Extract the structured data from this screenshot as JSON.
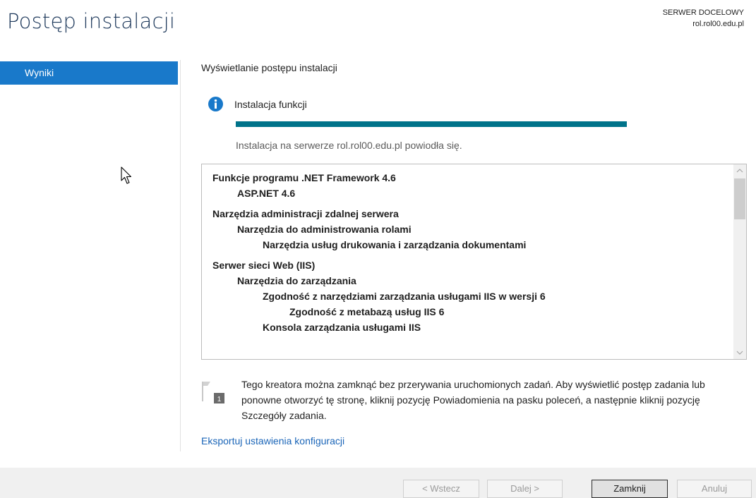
{
  "header": {
    "title": "Postęp instalacji",
    "server_label": "SERWER DOCELOWY",
    "server_name": "rol.rol00.edu.pl"
  },
  "sidebar": {
    "items": [
      {
        "label": "Wyniki",
        "selected": true
      }
    ]
  },
  "main": {
    "section_label": "Wyświetlanie postępu instalacji",
    "info_title": "Instalacja funkcji",
    "progress_percent": 100,
    "status_text": "Instalacja na serwerze rol.rol00.edu.pl powiodła się.",
    "results": [
      {
        "text": "Funkcje programu .NET Framework 4.6",
        "level": 0
      },
      {
        "text": "ASP.NET 4.6",
        "level": 1
      },
      {
        "text": "Narzędzia administracji zdalnej serwera",
        "level": 0
      },
      {
        "text": "Narzędzia do administrowania rolami",
        "level": 1
      },
      {
        "text": "Narzędzia usług drukowania i zarządzania dokumentami",
        "level": 2
      },
      {
        "text": "Serwer sieci Web (IIS)",
        "level": 0
      },
      {
        "text": "Narzędzia do zarządzania",
        "level": 1
      },
      {
        "text": "Zgodność z narzędziami zarządzania usługami IIS w wersji 6",
        "level": 2
      },
      {
        "text": "Zgodność z metabazą usług IIS 6",
        "level": 3
      },
      {
        "text": "Konsola zarządzania usługami IIS",
        "level": 2
      }
    ],
    "note_text": "Tego kreatora można zamknąć bez przerywania uruchomionych zadań. Aby wyświetlić postęp zadania lub ponowne otworzyć tę stronę, kliknij pozycję Powiadomienia na pasku poleceń, a następnie kliknij pozycję Szczegóły zadania.",
    "note_badge": "1",
    "export_link": "Eksportuj ustawienia konfiguracji"
  },
  "footer": {
    "back_label": "< Wstecz",
    "next_label": "Dalej >",
    "close_label": "Zamknij",
    "cancel_label": "Anuluj"
  },
  "colors": {
    "accent": "#1979ca",
    "progress": "#00738a",
    "link": "#1a65b8"
  },
  "icons": {
    "info": "info-icon",
    "flag": "notification-flag-icon",
    "cursor": "mouse-pointer-icon"
  }
}
